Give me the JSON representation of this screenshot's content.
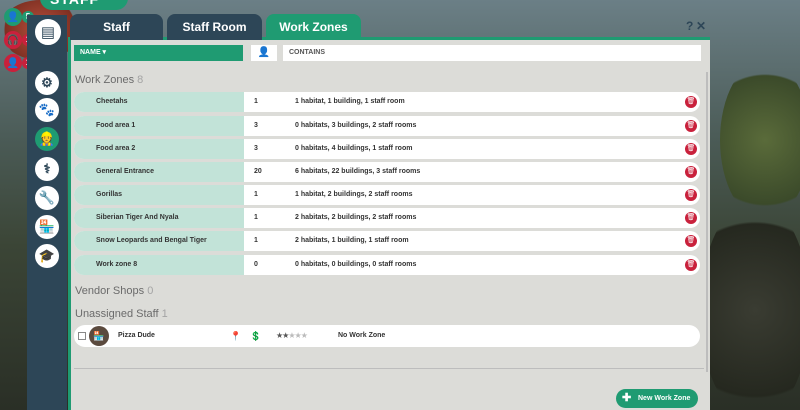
{
  "title": "STAFF",
  "tabs": [
    {
      "label": "Staff",
      "active": false
    },
    {
      "label": "Staff Room",
      "active": false
    },
    {
      "label": "Work Zones",
      "active": true
    }
  ],
  "window_controls": {
    "help": "?",
    "close": "✕"
  },
  "left_status": [
    {
      "icon": "person-icon",
      "count": "5",
      "color": "#1f9b72"
    },
    {
      "icon": "headphones-icon",
      "count": "1",
      "color": "#c9213c"
    },
    {
      "icon": "alert-person-icon",
      "count": "1",
      "color": "#c9213c"
    }
  ],
  "rail": [
    {
      "icon": "notes-icon"
    },
    {
      "icon": "gear-person-icon"
    },
    {
      "icon": "paw-icon"
    },
    {
      "icon": "staff-icon"
    },
    {
      "icon": "vet-icon"
    },
    {
      "icon": "wrench-icon"
    },
    {
      "icon": "shop-icon"
    },
    {
      "icon": "graduation-icon"
    }
  ],
  "columns": {
    "name": "NAME ▾",
    "contains": "CONTAINS"
  },
  "work_zones": {
    "title": "Work Zones",
    "count": "8",
    "rows": [
      {
        "name": "Cheetahs",
        "count": "1",
        "contains": "1 habitat, 1 building, 1 staff room"
      },
      {
        "name": "Food area 1",
        "count": "3",
        "contains": "0 habitats, 3 buildings, 2 staff rooms"
      },
      {
        "name": "Food area 2",
        "count": "3",
        "contains": "0 habitats, 4 buildings, 1 staff room"
      },
      {
        "name": "General Entrance",
        "count": "20",
        "contains": "6 habitats, 22 buildings, 3 staff rooms"
      },
      {
        "name": "Gorillas",
        "count": "1",
        "contains": "1 habitat, 2 buildings, 2 staff rooms"
      },
      {
        "name": "Siberian Tiger And Nyala",
        "count": "1",
        "contains": "2 habitats, 2 buildings, 2 staff rooms"
      },
      {
        "name": "Snow Leopards and Bengal Tiger",
        "count": "1",
        "contains": "2 habitats, 1 building, 1 staff room"
      },
      {
        "name": "Work zone 8",
        "count": "0",
        "contains": "0 habitats, 0 buildings, 0 staff rooms"
      }
    ]
  },
  "vendor_shops": {
    "title": "Vendor Shops",
    "count": "0"
  },
  "unassigned_staff": {
    "title": "Unassigned Staff",
    "count": "1",
    "rows": [
      {
        "name": "Pizza Dude",
        "stars": "★★",
        "stars_off": "★★★",
        "zone": "No Work Zone",
        "rating": 2
      }
    ]
  },
  "new_work_zone_label": "New Work Zone"
}
